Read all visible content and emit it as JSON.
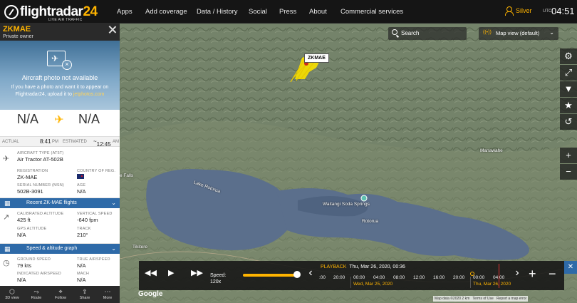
{
  "topbar": {
    "brand": "flightradar",
    "brand_num": "24",
    "tagline": "LIVE AIR TRAFFIC",
    "nav": [
      "Apps",
      "Add coverage",
      "Data / History",
      "Social",
      "Press",
      "About",
      "Commercial services"
    ],
    "user_label": "Silver",
    "utc_label": "UTC",
    "clock": "04:51"
  },
  "panel": {
    "registration_title": "ZKMAE",
    "owner": "Private owner",
    "photo_title": "Aircraft photo not available",
    "photo_hint": "If you have a photo and want it to appear on Flightradar24, upload it to",
    "photo_link": "jetphotos.com",
    "origin": "N/A",
    "destination": "N/A",
    "actual_label": "ACTUAL",
    "actual_time": "8:41",
    "actual_suffix": "PM",
    "estimated_label": "ESTIMATED",
    "estimated_time": "12:45",
    "estimated_suffix": "AM",
    "aircraft_type_label": "AIRCRAFT TYPE",
    "aircraft_type_code": "(AT5T)",
    "aircraft_type": "Air Tractor AT-502B",
    "registration_label": "REGISTRATION",
    "registration": "ZK-MAE",
    "country_label": "COUNTRY OF REG.",
    "serial_label": "SERIAL NUMBER (MSN)",
    "serial": "502B-3091",
    "age_label": "AGE",
    "age": "N/A",
    "recent_flights_bar": "Recent ZK-MAE flights",
    "cal_alt_label": "CALIBRATED ALTITUDE",
    "cal_alt": "425 ft",
    "vspeed_label": "VERTICAL SPEED",
    "vspeed": "-640 fpm",
    "gps_alt_label": "GPS ALTITUDE",
    "gps_alt": "N/A",
    "track_label": "TRACK",
    "track": "210°",
    "speed_bar": "Speed & altitude graph",
    "ground_speed_label": "GROUND SPEED",
    "ground_speed": "79 kts",
    "true_airspeed_label": "TRUE AIRSPEED",
    "true_airspeed": "N/A",
    "ind_airspeed_label": "INDICATED AIRSPEED",
    "ind_airspeed": "N/A",
    "mach_label": "MACH",
    "mach": "N/A",
    "bottom_nav": [
      "3D view",
      "Route",
      "Follow",
      "Share",
      "More"
    ]
  },
  "map": {
    "search_label": "Search",
    "map_view_label": "Map view (default)",
    "callsign_label": "ZKMAE",
    "places": [
      "Lake Rotorua",
      "Waitangi Soda Springs",
      "Rotorua",
      "Manawahe",
      "Tikitere",
      "e Falls"
    ],
    "attribution": "Map data ©2020  2 km",
    "terms": "Terms of Use",
    "report": "Report a map error",
    "google": "Google"
  },
  "playback": {
    "speed_label": "Speed:",
    "speed_value": "120x",
    "speed_fraction": 1.0,
    "title": "PLAYBACK",
    "datetime": "Thu, Mar 26, 2020, 00:36",
    "ticks": [
      ":00",
      "20:00",
      "00:00",
      "04:00",
      "08:00",
      "12:00",
      "16:00",
      "20:00",
      "00:00",
      "04:00"
    ],
    "date_1": "Wed, Mar 25, 2020",
    "date_2": "Thu, Mar 26, 2020"
  },
  "colors": {
    "accent": "#ffb400",
    "blue_bar": "#2e6aa8",
    "track": "#f5e000"
  }
}
